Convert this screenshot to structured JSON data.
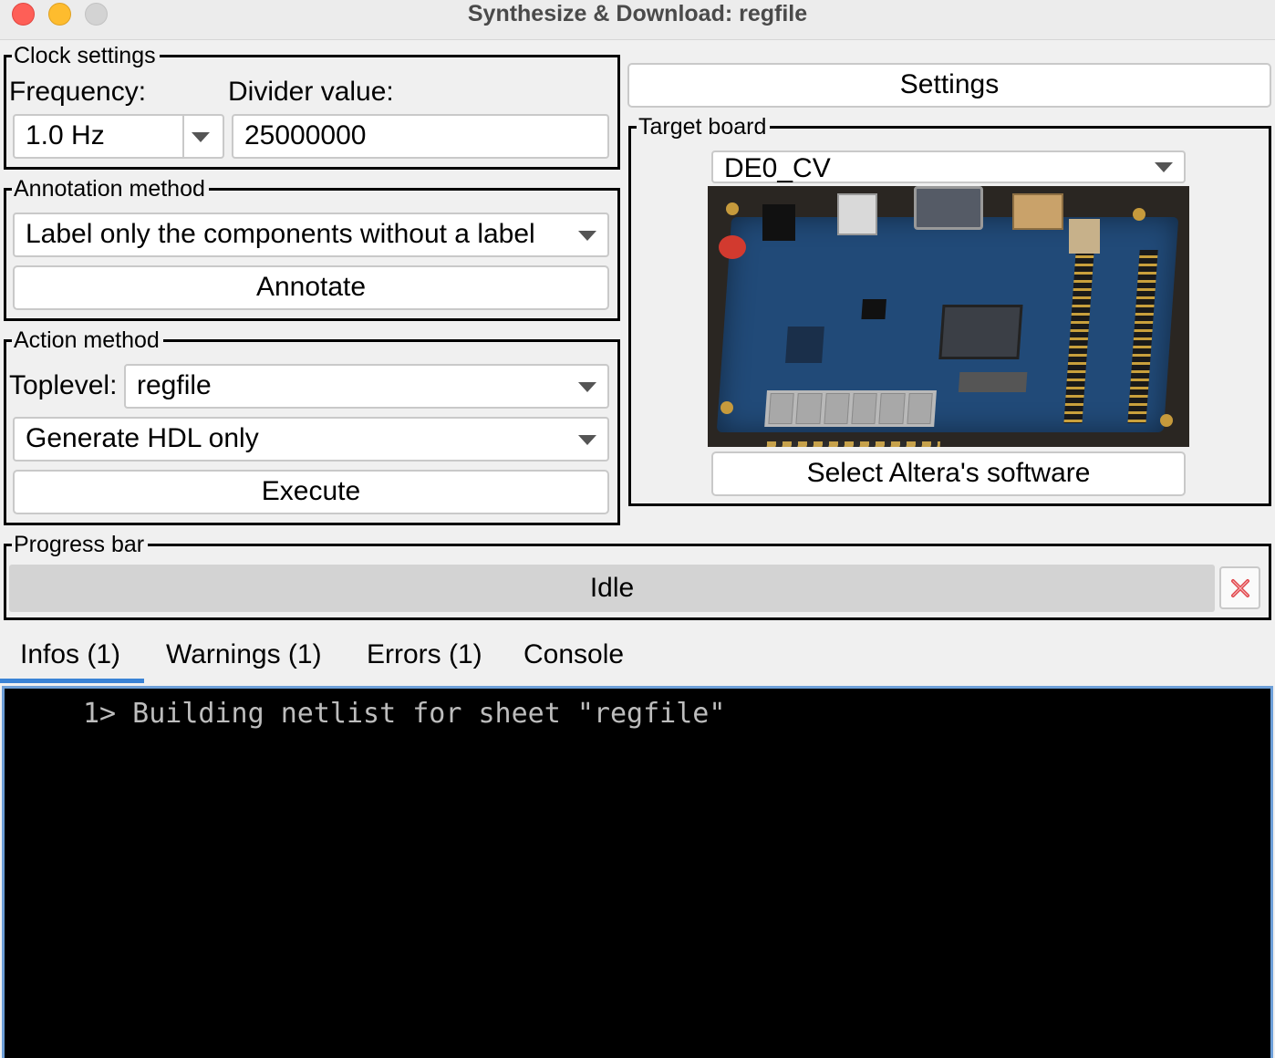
{
  "window": {
    "title": "Synthesize & Download: regfile"
  },
  "clock": {
    "group_label": "Clock settings",
    "frequency_label": "Frequency:",
    "frequency_value": "1.0 Hz",
    "divider_label": "Divider value:",
    "divider_value": "25000000"
  },
  "annotation": {
    "group_label": "Annotation method",
    "method_value": "Label only the components without a label",
    "annotate_button": "Annotate"
  },
  "action": {
    "group_label": "Action method",
    "toplevel_label": "Toplevel:",
    "toplevel_value": "regfile",
    "action_value": "Generate HDL only",
    "execute_button": "Execute"
  },
  "settings_button": "Settings",
  "target": {
    "group_label": "Target board",
    "board_value": "DE0_CV",
    "select_software_button": "Select Altera's software"
  },
  "progress": {
    "group_label": "Progress bar",
    "status_text": "Idle",
    "value_percent": 0
  },
  "tabs": [
    {
      "label": "Infos (1)",
      "active": true
    },
    {
      "label": "Warnings (1)",
      "active": false
    },
    {
      "label": "Errors (1)",
      "active": false
    },
    {
      "label": "Console",
      "active": false
    }
  ],
  "console": {
    "lines": [
      "1> Building netlist for sheet \"regfile\""
    ]
  },
  "colors": {
    "tab_active_underline": "#3a83d6",
    "console_bg": "#000000",
    "console_text": "#bdbdbd",
    "close_light": "#fe5f57",
    "minimize_light": "#febc2e",
    "cancel_icon": "#e0474c"
  },
  "icons": {
    "cancel": "red-x-icon",
    "dropdown": "triangle-down-icon"
  }
}
